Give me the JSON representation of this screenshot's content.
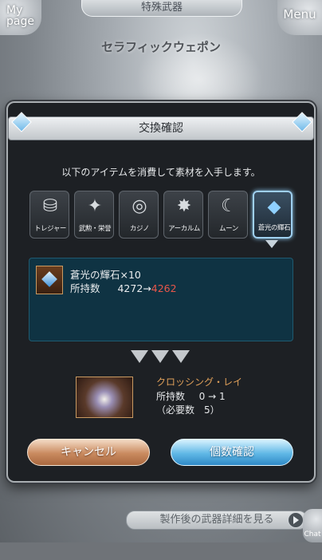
{
  "header": {
    "title": "特殊武器",
    "mypage_label": "My page",
    "menu_label": "Menu",
    "subtitle": "セラフィックウェポン"
  },
  "dialog": {
    "title": "交換確認",
    "instruction": "以下のアイテムを消費して素材を入手します。",
    "categories": [
      {
        "label": "トレジャー",
        "icon": "treasure-chest-icon",
        "glyph": "⛁"
      },
      {
        "label": "武勲・栄誉",
        "icon": "medals-icon",
        "glyph": "✦"
      },
      {
        "label": "カジノ",
        "icon": "casino-chip-icon",
        "glyph": "◎"
      },
      {
        "label": "アーカルム",
        "icon": "arcarum-star-icon",
        "glyph": "✸"
      },
      {
        "label": "ムーン",
        "icon": "moon-icon",
        "glyph": "☾"
      },
      {
        "label": "蒼光の輝石",
        "icon": "blue-gem-icon",
        "glyph": "◆"
      }
    ],
    "selected_category": "蒼光の輝石",
    "consume_item": {
      "name": "蒼光の輝石×10",
      "owned_label": "所持数",
      "before": "4272",
      "arrow": "→",
      "after": "4262"
    },
    "result_item": {
      "name": "クロッシング・レイ",
      "owned_label": "所持数",
      "before": "0",
      "arrow": "→",
      "after": "1",
      "required_text": "（必要数　5）"
    },
    "cancel_label": "キャンセル",
    "confirm_label": "個数確認"
  },
  "footer": {
    "weapon_detail_label": "製作後の武器詳細を見る",
    "chat_label": "Chat"
  },
  "colors": {
    "dialog_bg": "#1d2024",
    "panel_bg": "#0f3343",
    "after_value": "#e8564a",
    "result_name": "#e0a05a",
    "cancel_button": "#c98a5f",
    "confirm_button": "#60b8e6"
  }
}
